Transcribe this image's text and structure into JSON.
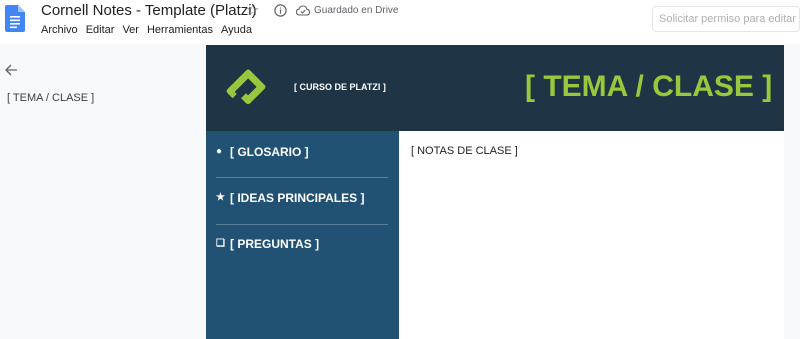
{
  "app": {
    "title": "Cornell Notes - Template (Platzi)",
    "save_status": "Guardado en Drive",
    "request_button": "Solicitar permiso para editar",
    "brand_color": "#4285f4"
  },
  "menu": [
    {
      "label": "Archivo"
    },
    {
      "label": "Editar"
    },
    {
      "label": "Ver"
    },
    {
      "label": "Herramientas"
    },
    {
      "label": "Ayuda"
    }
  ],
  "outline": {
    "items": [
      {
        "label": "[ TEMA / CLASE ]"
      }
    ]
  },
  "document": {
    "header": {
      "course_label": "[ CURSO DE PLATZI ]",
      "topic_title": "[ TEMA / CLASE ]",
      "background": "#1f3444",
      "accent": "#98c93c"
    },
    "cues": [
      {
        "bullet": "●",
        "label": "[ GLOSARIO ]"
      },
      {
        "bullet": "★",
        "label": "[ IDEAS PRINCIPALES ]"
      },
      {
        "bullet": "❏",
        "label": "[ PREGUNTAS ]"
      }
    ],
    "cue_background": "#215173",
    "notes_label": "[ NOTAS DE CLASE ]"
  },
  "icons": {
    "docs": "google-docs-icon",
    "star": "star-icon",
    "info": "info-icon",
    "cloud": "cloud-saved-icon",
    "back": "back-arrow-icon",
    "logo": "platzi-logo-icon"
  }
}
